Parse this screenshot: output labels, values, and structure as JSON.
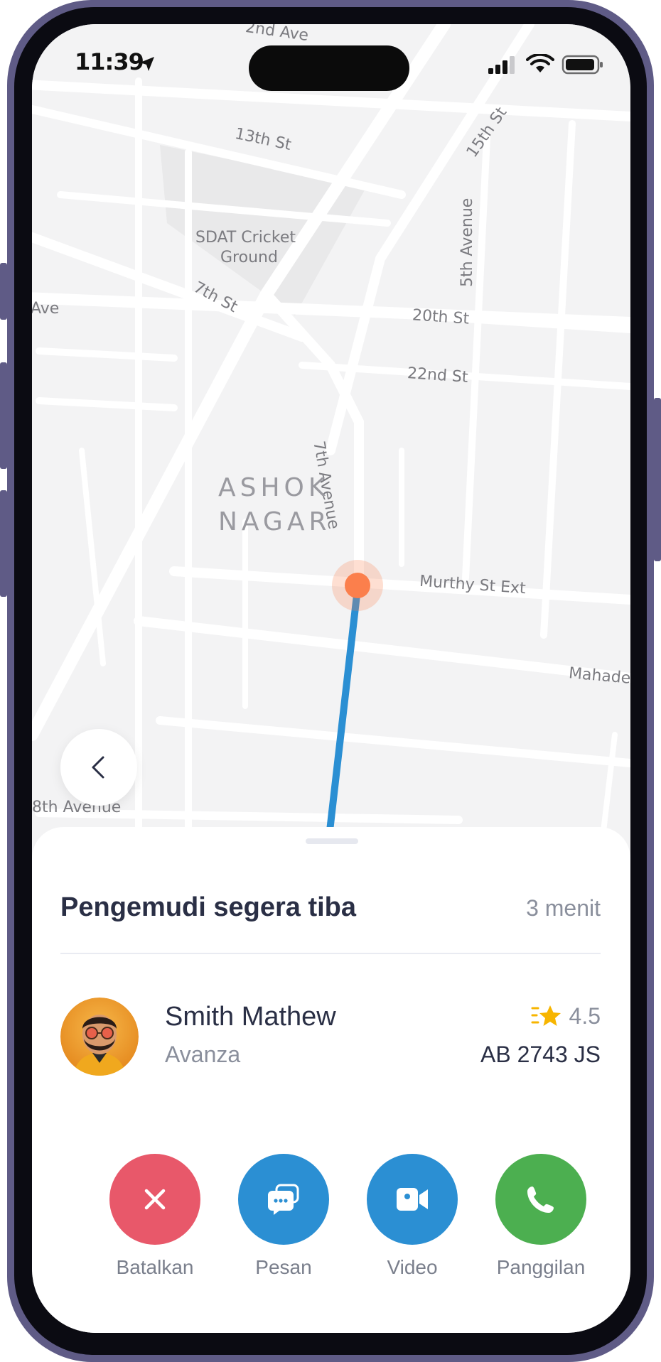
{
  "status_bar": {
    "time": "11:39"
  },
  "map": {
    "labels": {
      "second_ave": "2nd Ave",
      "thirteenth_st": "13th St",
      "fifteenth_st": "15th St",
      "cricket_ground_line1": "SDAT Cricket",
      "cricket_ground_line2": "Ground",
      "seventh_st": "7th St",
      "ave_left": "Ave",
      "fifth_avenue": "5th Avenue",
      "twentieth_st": "20th St",
      "twentysecond_st": "22nd St",
      "seventh_avenue": "7th Avenue",
      "area_line1": "ASHOK",
      "area_line2": "NAGAR",
      "murthy_st_ext": "Murthy St Ext",
      "mahade": "Mahade",
      "eighth_avenue": "8th Avenue"
    },
    "colors": {
      "route": "#2b8fd3",
      "marker": "#fb7f4c",
      "road": "#ffffff",
      "land": "#f3f3f4"
    }
  },
  "sheet": {
    "title": "Pengemudi segera tiba",
    "eta": "3 menit",
    "driver": {
      "name": "Smith Mathew",
      "car": "Avanza",
      "rating": "4.5",
      "plate": "AB 2743 JS",
      "avatar_icon": "driver-avatar"
    },
    "actions": [
      {
        "label": "Batalkan",
        "icon": "close-icon",
        "color": "#e8586a"
      },
      {
        "label": "Pesan",
        "icon": "chat-icon",
        "color": "#2b8fd3"
      },
      {
        "label": "Video",
        "icon": "video-icon",
        "color": "#2b8fd3"
      },
      {
        "label": "Panggilan",
        "icon": "phone-icon",
        "color": "#4caf50"
      }
    ]
  }
}
